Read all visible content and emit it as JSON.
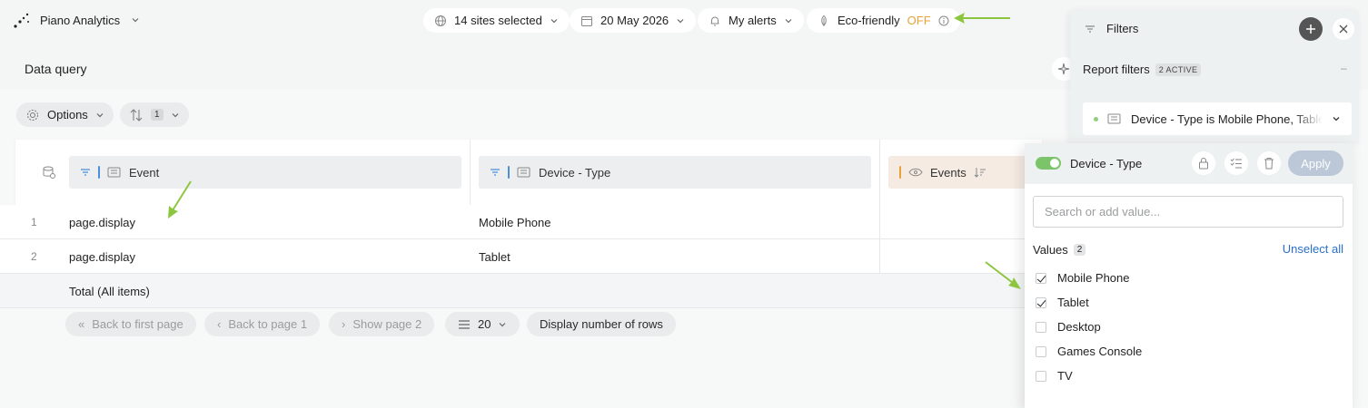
{
  "app": {
    "name": "Piano Analytics"
  },
  "topbar": {
    "sites": "14 sites selected",
    "date": "20 May 2026",
    "alerts": "My alerts",
    "eco_label": "Eco-friendly",
    "eco_state": "OFF"
  },
  "page": {
    "title": "Data query"
  },
  "toolbar": {
    "options_label": "Options",
    "sort_count": "1"
  },
  "table": {
    "columns": [
      {
        "label": "Event"
      },
      {
        "label": "Device - Type"
      },
      {
        "label": "Events"
      }
    ],
    "rows": [
      {
        "num": "1",
        "event": "page.display",
        "device": "Mobile Phone"
      },
      {
        "num": "2",
        "event": "page.display",
        "device": "Tablet"
      }
    ],
    "total_label": "Total (All items)"
  },
  "pagination": {
    "first": "Back to first page",
    "back": "Back to page 1",
    "next": "Show page 2",
    "rows_value": "20",
    "rows_label": "Display number of rows"
  },
  "filters": {
    "title": "Filters",
    "report_filters": "Report filters",
    "active_badge": "2 ACTIVE",
    "filter_summary": "Device - Type is Mobile Phone, Tablet"
  },
  "editor": {
    "title": "Device - Type",
    "apply": "Apply",
    "search_placeholder": "Search or add value...",
    "values_label": "Values",
    "values_count": "2",
    "unselect_all": "Unselect all",
    "options": [
      {
        "label": "Mobile Phone",
        "checked": true
      },
      {
        "label": "Tablet",
        "checked": true
      },
      {
        "label": "Desktop",
        "checked": false
      },
      {
        "label": "Games Console",
        "checked": false
      },
      {
        "label": "TV",
        "checked": false
      }
    ]
  },
  "colors": {
    "accent_green": "#7cc46a",
    "link_blue": "#2a6fc9",
    "eco_off": "#e8a23a",
    "apply_disabled": "#bcc7d7"
  }
}
